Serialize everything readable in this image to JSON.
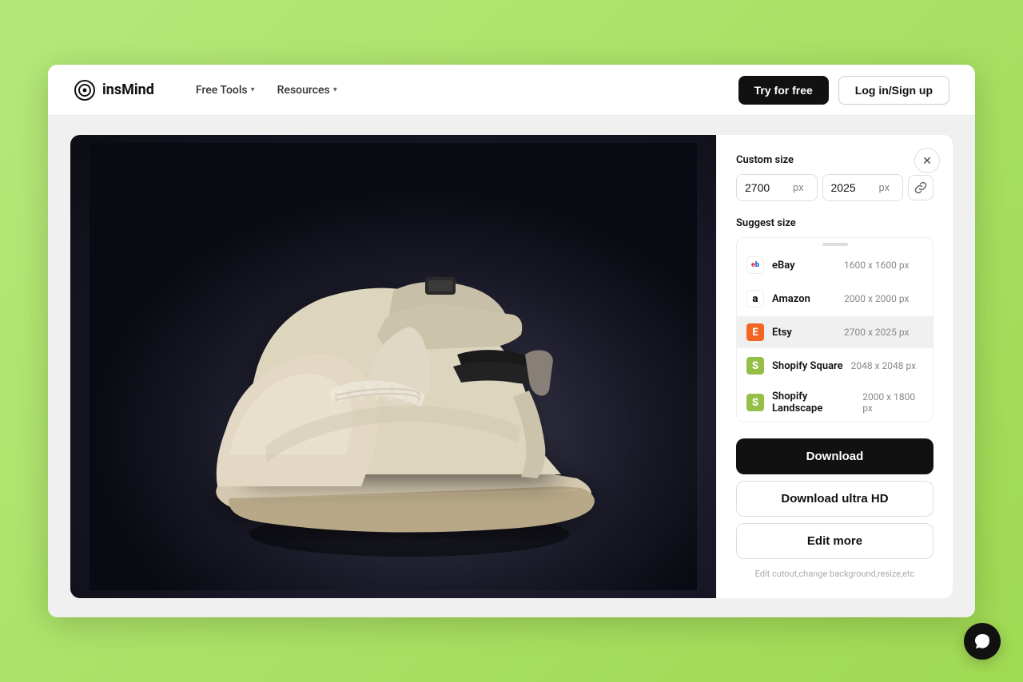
{
  "navbar": {
    "logo_text": "insMind",
    "nav_items": [
      {
        "label": "Free Tools",
        "has_dropdown": true
      },
      {
        "label": "Resources",
        "has_dropdown": true
      }
    ],
    "btn_try": "Try for free",
    "btn_login": "Log in/Sign up"
  },
  "panel": {
    "custom_size_label": "Custom size",
    "width_value": "2700",
    "height_value": "2025",
    "unit": "px",
    "suggest_size_label": "Suggest size",
    "platforms": [
      {
        "name": "eBay",
        "size": "1600 x 1600 px",
        "icon_type": "ebay",
        "active": false
      },
      {
        "name": "Amazon",
        "size": "2000 x 2000 px",
        "icon_type": "amazon",
        "active": false
      },
      {
        "name": "Etsy",
        "size": "2700 x 2025 px",
        "icon_type": "etsy",
        "active": true
      },
      {
        "name": "Shopify Square",
        "size": "2048 x 2048 px",
        "icon_type": "shopify",
        "active": false
      },
      {
        "name": "Shopify Landscape",
        "size": "2000 x 1800 px",
        "icon_type": "shopify",
        "active": false
      }
    ],
    "btn_download": "Download",
    "btn_download_hd": "Download ultra HD",
    "btn_edit": "Edit more",
    "edit_note": "Edit cutout,change background,resize,etc"
  }
}
